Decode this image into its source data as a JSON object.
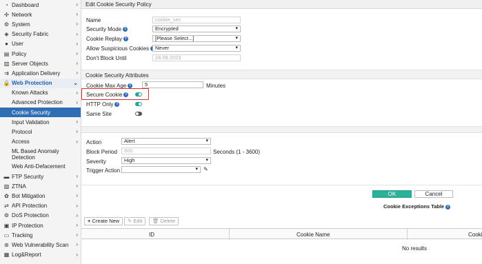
{
  "sidebar": {
    "items": [
      {
        "label": "Dashboard",
        "icon": "dashboard-icon",
        "glyph": "◔",
        "chevron": true
      },
      {
        "label": "Network",
        "icon": "network-icon",
        "glyph": "✣",
        "chevron": true
      },
      {
        "label": "System",
        "icon": "gear-icon",
        "glyph": "⚙",
        "chevron": true
      },
      {
        "label": "Security Fabric",
        "icon": "fabric-icon",
        "glyph": "◈",
        "chevron": true
      },
      {
        "label": "User",
        "icon": "user-icon",
        "glyph": "●",
        "chevron": true
      },
      {
        "label": "Policy",
        "icon": "policy-icon",
        "glyph": "▤",
        "chevron": true
      },
      {
        "label": "Server Objects",
        "icon": "server-icon",
        "glyph": "▥",
        "chevron": true
      },
      {
        "label": "Application Delivery",
        "icon": "app-delivery-icon",
        "glyph": "⇉",
        "chevron": true
      },
      {
        "label": "Web Protection",
        "icon": "lock-icon",
        "glyph": "🔒",
        "chevron": false
      },
      {
        "label": "Known Attacks",
        "sub": true,
        "chevron": true
      },
      {
        "label": "Advanced Protection",
        "sub": true,
        "chevron": true
      },
      {
        "label": "Cookie Security",
        "sub": true,
        "chevron": false
      },
      {
        "label": "Input Validation",
        "sub": true,
        "chevron": true
      },
      {
        "label": "Protocol",
        "sub": true,
        "chevron": true
      },
      {
        "label": "Access",
        "sub": true,
        "chevron": true
      },
      {
        "label": "ML Based Anomaly Detection",
        "sub": true,
        "chevron": false
      },
      {
        "label": "Web Anti-Defacement",
        "sub": true,
        "chevron": false
      },
      {
        "label": "FTP Security",
        "icon": "ftp-icon",
        "glyph": "▬",
        "chevron": true
      },
      {
        "label": "ZTNA",
        "icon": "ztna-icon",
        "glyph": "▨",
        "chevron": true
      },
      {
        "label": "Bot Mitigation",
        "icon": "bot-icon",
        "glyph": "✿",
        "chevron": true
      },
      {
        "label": "API Protection",
        "icon": "api-icon",
        "glyph": "⇄",
        "chevron": true
      },
      {
        "label": "DoS Protection",
        "icon": "dos-icon",
        "glyph": "⚙",
        "chevron": true
      },
      {
        "label": "IP Protection",
        "icon": "ip-icon",
        "glyph": "▣",
        "chevron": true
      },
      {
        "label": "Tracking",
        "icon": "tracking-icon",
        "glyph": "▭",
        "chevron": true
      },
      {
        "label": "Web Vulnerability Scan",
        "icon": "scan-icon",
        "glyph": "⊛",
        "chevron": true
      },
      {
        "label": "Log&Report",
        "icon": "report-icon",
        "glyph": "▦",
        "chevron": true
      }
    ]
  },
  "header": {
    "title": "Edit Cookie Security Policy"
  },
  "form": {
    "name_label": "Name",
    "name_value": "cookie_sec",
    "security_mode_label": "Security Mode",
    "security_mode_value": "Encrypted",
    "cookie_replay_label": "Cookie Replay",
    "cookie_replay_value": "[Please Select...]",
    "allow_suspicious_label": "Allow Suspicious Cookies",
    "allow_suspicious_value": "Never",
    "dont_block_label": "Don't Block Until",
    "dont_block_value": "24.08.2023"
  },
  "attributes": {
    "section_title": "Cookie Security Attributes",
    "max_age_label": "Cookie Max Age",
    "max_age_value": "5",
    "max_age_unit": "Minutes",
    "secure_cookie_label": "Secure Cookie",
    "secure_cookie_on": true,
    "http_only_label": "HTTP Only",
    "http_only_on": true,
    "same_site_label": "Same Site",
    "same_site_on": false
  },
  "action": {
    "action_label": "Action",
    "action_value": "Alert",
    "block_period_label": "Block Period",
    "block_period_value": "600",
    "block_period_unit": "Seconds (1 - 3600)",
    "severity_label": "Severity",
    "severity_value": "High",
    "trigger_label": "Trigger Action",
    "trigger_value": ""
  },
  "buttons": {
    "ok": "OK",
    "cancel": "Cancel"
  },
  "exceptions": {
    "title": "Cookie Exceptions Table",
    "create_new": "Create New",
    "edit": "Edit",
    "delete": "Delete",
    "columns": [
      "ID",
      "Cookie Name",
      "Cooki"
    ],
    "empty": "No results"
  },
  "colors": {
    "accent_blue": "#2f6db5",
    "ok_green": "#2bb09a",
    "toggle_on": "#2aa198",
    "highlight_red": "#d0312d"
  }
}
